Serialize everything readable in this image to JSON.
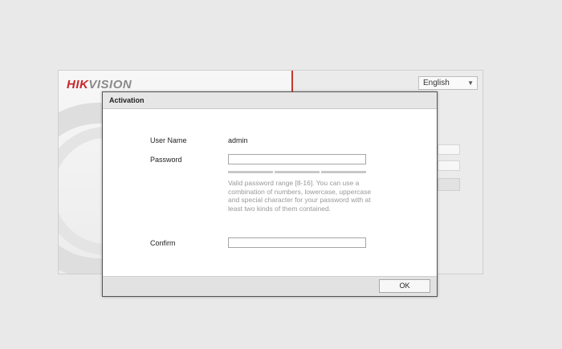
{
  "background": {
    "logo": {
      "part1": "HIK",
      "part2": "VISION"
    },
    "language_select": {
      "value": "English"
    }
  },
  "dialog": {
    "title": "Activation",
    "username_label": "User Name",
    "username_value": "admin",
    "password_label": "Password",
    "password_value": "",
    "password_hint": "Valid password range [8-16]. You can use a combination of numbers, lowercase, uppercase and special character for your password with at least two kinds of them contained.",
    "confirm_label": "Confirm",
    "confirm_value": "",
    "ok_label": "OK"
  },
  "colors": {
    "brand_red": "#c9252b",
    "strength_bar": "#c8c8c8"
  },
  "icons": {
    "language_dropdown": "chevron-down-icon"
  }
}
